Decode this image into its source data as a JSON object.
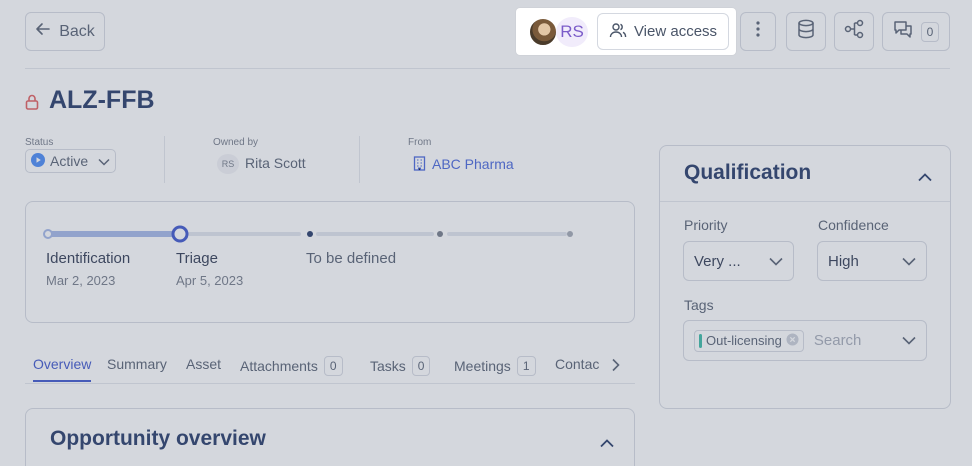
{
  "header": {
    "back_label": "Back",
    "avatar_initials": "RS",
    "view_access_label": "View access",
    "comments_count": "0"
  },
  "title": "ALZ-FFB",
  "meta": {
    "status_label": "Status",
    "status_value": "Active",
    "owned_label": "Owned by",
    "owner_initials": "RS",
    "owner_name": "Rita Scott",
    "from_label": "From",
    "from_value": "ABC Pharma"
  },
  "stages": [
    {
      "name": "Identification",
      "date": "Mar 2, 2023"
    },
    {
      "name": "Triage",
      "date": "Apr 5, 2023"
    },
    {
      "name": "To be defined",
      "date": ""
    }
  ],
  "tabs": [
    {
      "label": "Overview",
      "count": ""
    },
    {
      "label": "Summary",
      "count": ""
    },
    {
      "label": "Asset",
      "count": ""
    },
    {
      "label": "Attachments",
      "count": "0"
    },
    {
      "label": "Tasks",
      "count": "0"
    },
    {
      "label": "Meetings",
      "count": "1"
    },
    {
      "label": "Contac",
      "count": ""
    }
  ],
  "overview": {
    "title": "Opportunity overview"
  },
  "qualification": {
    "title": "Qualification",
    "priority_label": "Priority",
    "priority_value": "Very ...",
    "confidence_label": "Confidence",
    "confidence_value": "High",
    "tags_label": "Tags",
    "tag": "Out-licensing",
    "tags_placeholder": "Search"
  },
  "colors": {
    "accent": "#2f49c9",
    "navy": "#142a5c",
    "lock": "#e05252",
    "link": "#3a5bd9",
    "status": "#3b82f6"
  }
}
